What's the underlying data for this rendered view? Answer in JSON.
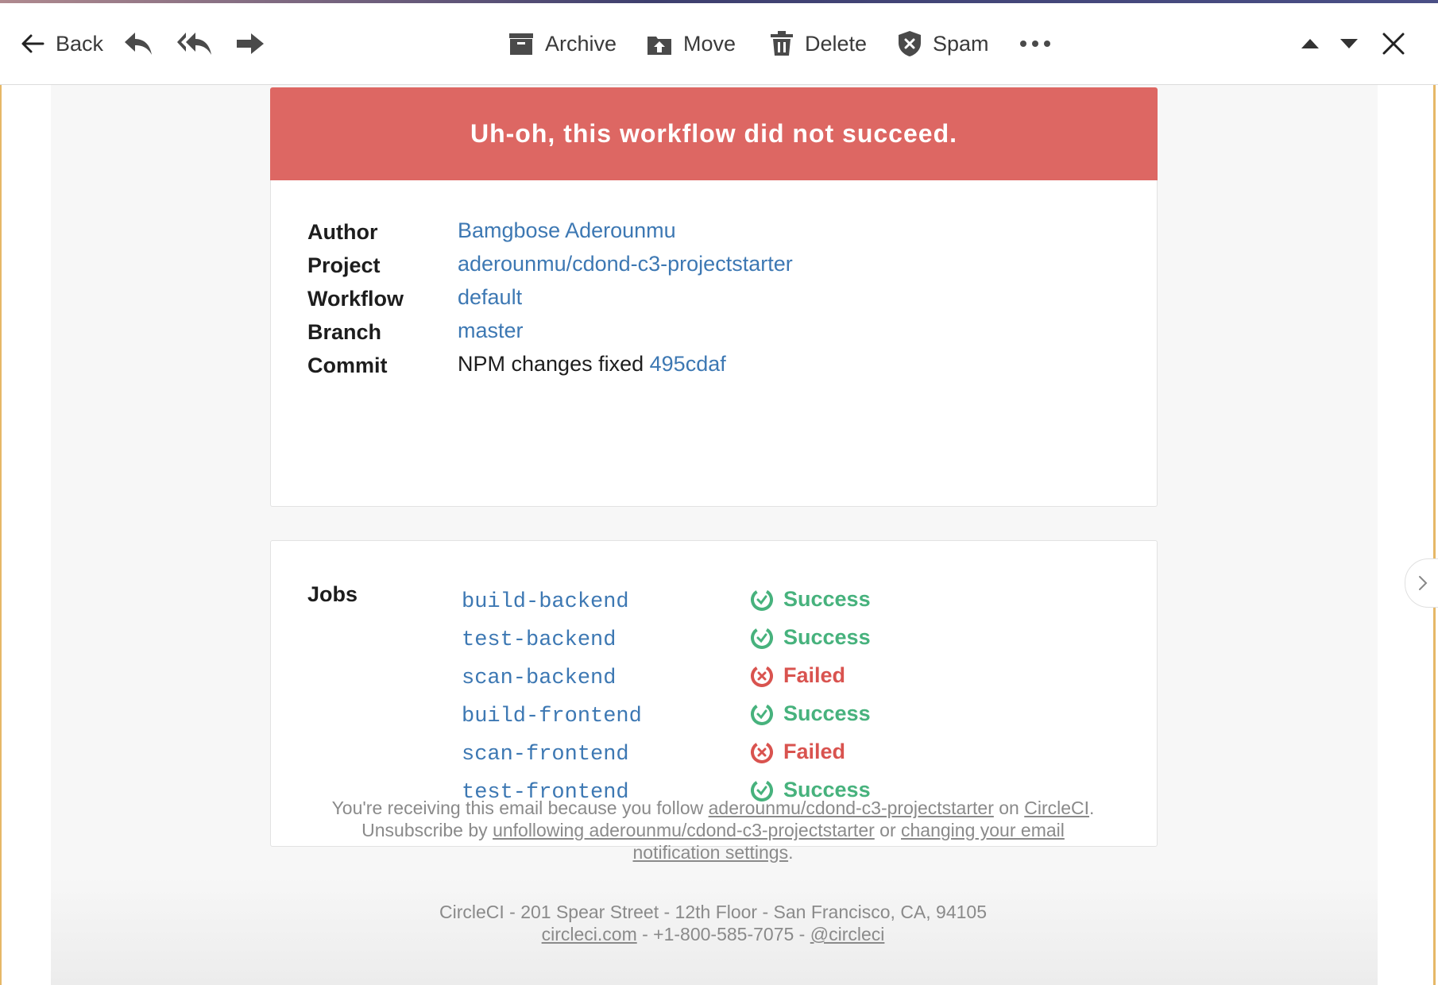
{
  "toolbar": {
    "back_label": "Back",
    "actions": [
      {
        "label": "Archive",
        "icon": "archive-icon"
      },
      {
        "label": "Move",
        "icon": "move-icon"
      },
      {
        "label": "Delete",
        "icon": "trash-icon"
      },
      {
        "label": "Spam",
        "icon": "shield-icon"
      }
    ]
  },
  "email": {
    "banner": "Uh-oh, this workflow did not succeed.",
    "details": {
      "author_label": "Author",
      "author": "Bamgbose Aderounmu",
      "project_label": "Project",
      "project": "aderounmu/cdond-c3-projectstarter",
      "workflow_label": "Workflow",
      "workflow": "default",
      "branch_label": "Branch",
      "branch": "master",
      "commit_label": "Commit",
      "commit_message": "NPM changes fixed",
      "commit_hash": "495cdaf"
    },
    "jobs_label": "Jobs",
    "jobs": [
      {
        "name": "build-backend",
        "status": "Success"
      },
      {
        "name": "test-backend",
        "status": "Success"
      },
      {
        "name": "scan-backend",
        "status": "Failed"
      },
      {
        "name": "build-frontend",
        "status": "Success"
      },
      {
        "name": "scan-frontend",
        "status": "Failed"
      },
      {
        "name": "test-frontend",
        "status": "Success"
      }
    ],
    "footer": {
      "line1_prefix": "You're receiving this email because you follow",
      "line1_link": "aderounmu/cdond-c3-projectstarter",
      "line1_on": "on",
      "line1_circleci": "CircleCI",
      "line1_end": ".",
      "line2_prefix": "Unsubscribe by",
      "line2_link": "unfollowing aderounmu/cdond-c3-projectstarter",
      "line2_or": "or",
      "line2_link2": "changing your email notification settings",
      "line2_end": ".",
      "address": "CircleCI - 201 Spear Street - 12th Floor - San Francisco, CA, 94105",
      "site": "circleci.com",
      "phone_sep": "- +1-800-585-7075 -",
      "twitter": "@circleci"
    }
  },
  "colors": {
    "banner": "#dd6763",
    "link": "#3d78b3",
    "success": "#47b27d",
    "failed": "#d9534f"
  }
}
